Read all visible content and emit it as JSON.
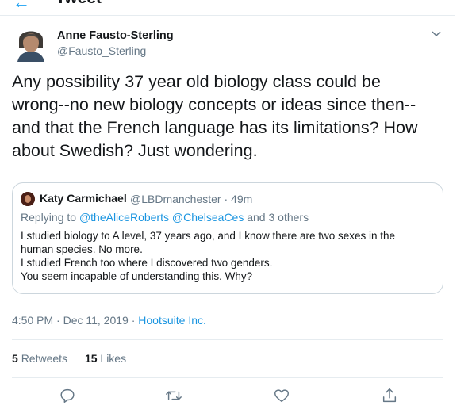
{
  "header": {
    "title": "Tweet"
  },
  "tweet": {
    "author_name": "Anne Fausto-Sterling",
    "author_handle": "@Fausto_Sterling",
    "text": "Any possibility 37 year old biology class could be\nwrong--no new biology concepts or ideas since then--\nand that the French language has its limitations? How\nabout Swedish? Just wondering.",
    "time": "4:50 PM · Dec 11, 2019",
    "dot": " · ",
    "source": "Hootsuite Inc.",
    "retweets_count": "5",
    "retweets_label": "Retweets",
    "likes_count": "15",
    "likes_label": "Likes"
  },
  "quote": {
    "author_name": "Katy Carmichael",
    "author_handle": "@LBDmanchester · 49m",
    "reply_prefix": "Replying to ",
    "reply_users": "@theAliceRoberts @ChelseaCes",
    "reply_suffix": " and 3 others",
    "text": "I studied biology to A level, 37 years ago, and I know there are two sexes in the\nhuman species. No more.\nI studied French too where I discovered two genders.\nYou seem incapable of understanding this. Why?"
  },
  "colors": {
    "accent": "#1b95e0",
    "muted": "#657786",
    "border": "#e6ecf0",
    "text": "#14171a"
  },
  "icons": [
    "back-arrow-icon",
    "chevron-down-icon",
    "reply-icon",
    "retweet-icon",
    "like-icon",
    "share-icon"
  ]
}
